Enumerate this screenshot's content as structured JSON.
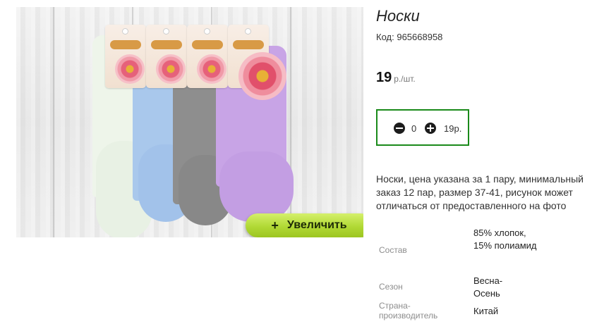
{
  "product": {
    "title": "Носки",
    "code_label": "Код:",
    "code": "965668958",
    "price_value": "19",
    "price_unit": "р./шт.",
    "description": "Носки, цена указана за 1 пару, минимальный заказ 12 пар, размер 37-41, рисунок может отличаться от предоставленного на фото"
  },
  "gallery": {
    "zoom_label": "Увеличить",
    "zoom_plus": "+"
  },
  "cart": {
    "quantity": "0",
    "sum": "19р."
  },
  "specs": [
    {
      "label": "Состав",
      "value": "85% хлопок, 15% полиамид"
    },
    {
      "label": "Сезон",
      "value": "Весна-Осень"
    },
    {
      "label": "Страна-производитель",
      "value": "Китай"
    }
  ],
  "colors": {
    "accent_green": "#1a8a1a",
    "zoom_button": "#b1d935"
  }
}
